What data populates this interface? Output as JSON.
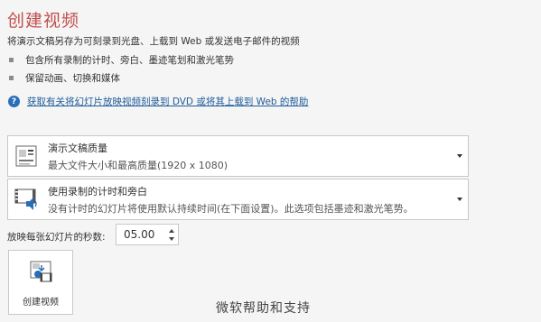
{
  "page": {
    "title": "创建视频",
    "description": "将演示文稿另存为可刻录到光盘、上载到 Web 或发送电子邮件的视频",
    "bullets": [
      "包含所有录制的计时、旁白、墨迹笔划和激光笔势",
      "保留动画、切换和媒体"
    ],
    "help_link": "获取有关将幻灯片放映视频刻录到 DVD 或将其上载到 Web 的帮助"
  },
  "quality_dropdown": {
    "title": "演示文稿质量",
    "subtitle": "最大文件大小和最高质量(1920 x 1080)",
    "icon": "presentation-quality-icon"
  },
  "timing_dropdown": {
    "title": "使用录制的计时和旁白",
    "subtitle": "没有计时的幻灯片将使用默认持续时间(在下面设置)。此选项包括墨迹和激光笔势。",
    "icon": "video-narration-icon"
  },
  "seconds": {
    "label": "放映每张幻灯片的秒数:",
    "value": "05.00"
  },
  "create_button": {
    "label": "创建视频",
    "icon": "create-video-icon"
  },
  "watermark": "微软帮助和支持",
  "colors": {
    "title": "#c0504d",
    "link": "#1f5c99",
    "help_icon": "#2a6ebb"
  }
}
